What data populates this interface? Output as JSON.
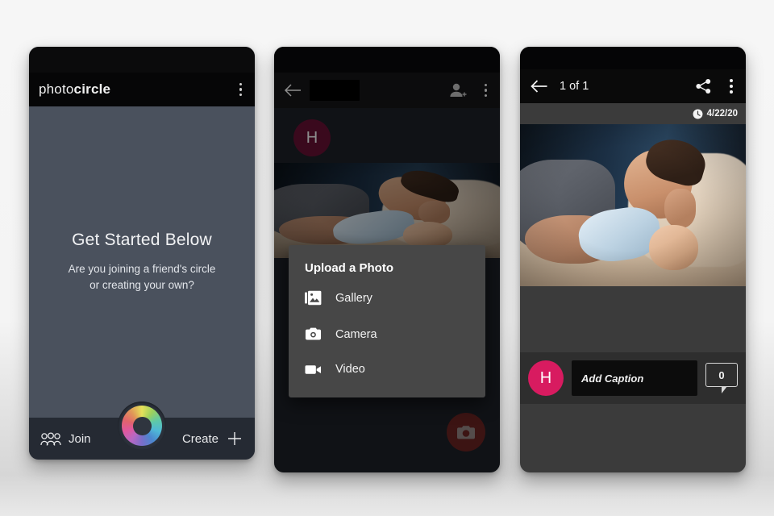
{
  "panel1": {
    "brand_light": "photo",
    "brand_bold": "circle",
    "overflow_icon": "kebab-menu-icon",
    "title": "Get Started Below",
    "subtitle_line1": "Are you joining a friend's circle",
    "subtitle_line2": "or creating your own?",
    "join_label": "Join",
    "join_icon": "group-people-icon",
    "create_label": "Create",
    "create_icon": "plus-icon",
    "fab_icon": "color-wheel-icon"
  },
  "panel2": {
    "back_icon": "back-arrow-icon",
    "title_redacted": "",
    "add_person_icon": "add-person-icon",
    "overflow_icon": "kebab-menu-icon",
    "avatar_initial": "H",
    "avatar_color": "#6b1235",
    "fab_icon": "camera-icon",
    "fab_color": "#6e2523",
    "dialog": {
      "title": "Upload a Photo",
      "items": [
        {
          "label": "Gallery",
          "icon": "gallery-icon"
        },
        {
          "label": "Camera",
          "icon": "camera-icon"
        },
        {
          "label": "Video",
          "icon": "video-camera-icon"
        }
      ]
    }
  },
  "panel3": {
    "back_icon": "back-arrow-icon",
    "counter": "1 of 1",
    "share_icon": "share-icon",
    "overflow_icon": "kebab-menu-icon",
    "clock_icon": "clock-icon",
    "date": "4/22/20",
    "avatar_initial": "H",
    "avatar_color": "#d81b60",
    "caption_placeholder": "Add Caption",
    "comment_count": "0",
    "comment_icon": "speech-bubble-icon"
  }
}
